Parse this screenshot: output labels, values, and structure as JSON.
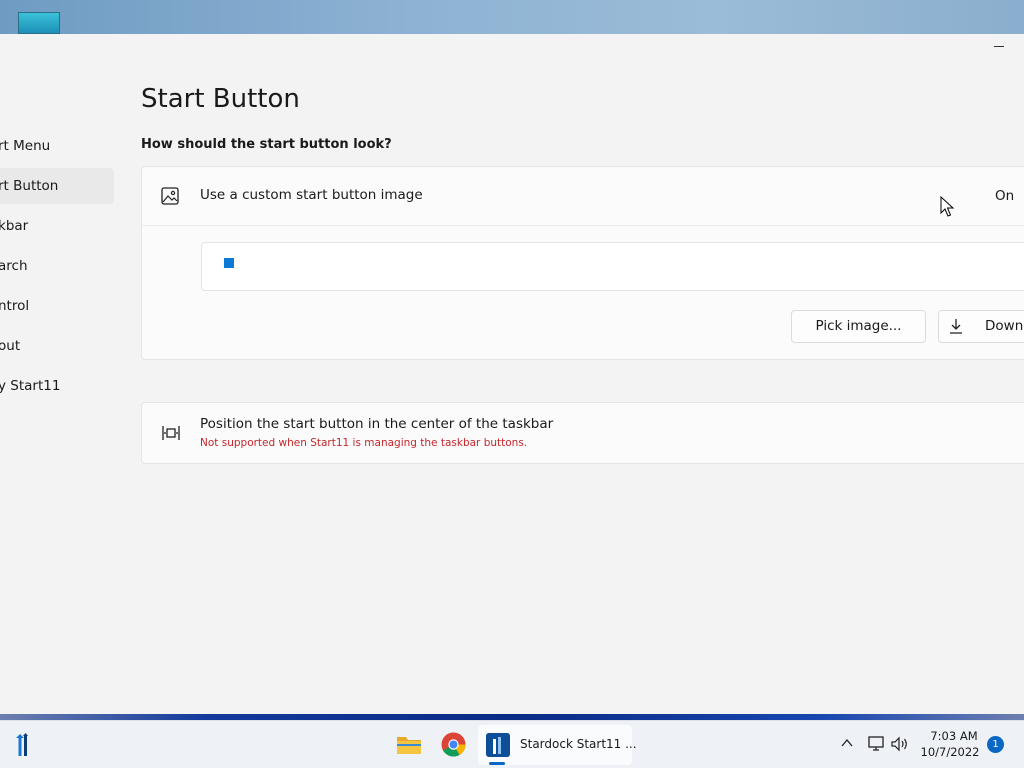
{
  "window": {
    "page_title": "Start Button",
    "section_question": "How should the start button look?"
  },
  "sidebar": {
    "items": [
      {
        "label": "rt Menu"
      },
      {
        "label": "rt Button"
      },
      {
        "label": "kbar"
      },
      {
        "label": "arch"
      },
      {
        "label": "ntrol"
      },
      {
        "label": "out"
      },
      {
        "label": "y Start11"
      }
    ],
    "active_index": 1
  },
  "custom_image": {
    "label": "Use a custom start button image",
    "state": "On",
    "icon": "image-icon",
    "pick_button": "Pick image...",
    "download_button": "Downl"
  },
  "center_position": {
    "label": "Position the start button in the center of the taskbar",
    "note": "Not supported when Start11 is managing the taskbar buttons.",
    "icon": "center-align-icon"
  },
  "taskbar": {
    "app_label": "Stardock Start11 ...",
    "time": "7:03 AM",
    "date": "10/7/2022",
    "notification_count": "1"
  },
  "colors": {
    "accent": "#0a67c4",
    "warning_text": "#c4262b",
    "window_bg": "#f3f3f3"
  }
}
